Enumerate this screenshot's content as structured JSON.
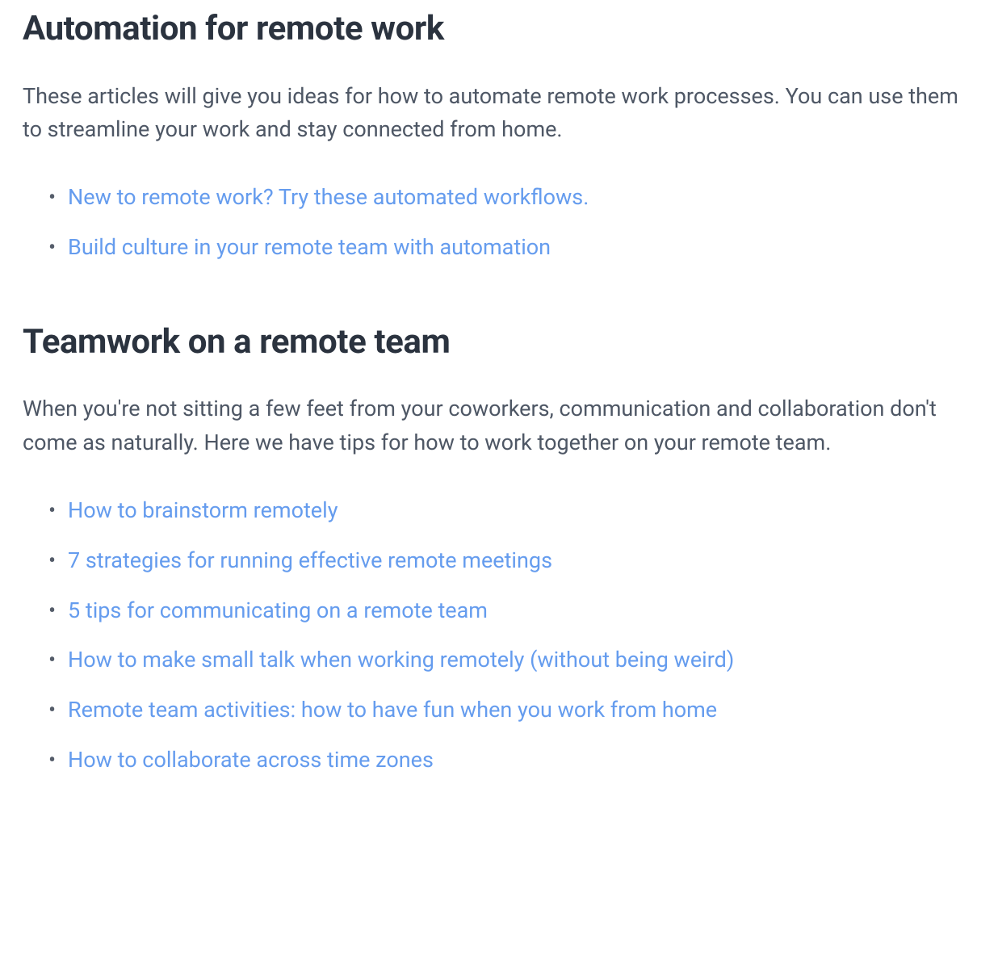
{
  "sections": [
    {
      "heading": "Automation for remote work",
      "paragraph": "These articles will give you ideas for how to automate remote work processes. You can use them to streamline your work and stay connected from home.",
      "links": [
        "New to remote work? Try these automated workflows.",
        "Build culture in your remote team with automation"
      ]
    },
    {
      "heading": "Teamwork on a remote team",
      "paragraph": "When you're not sitting a few feet from your coworkers, communication and collaboration don't come as naturally. Here we have tips for how to work together on your remote team.",
      "links": [
        "How to brainstorm remotely",
        "7 strategies for running effective remote meetings",
        "5 tips for communicating on a remote team",
        "How to make small talk when working remotely (without being weird)",
        "Remote team activities: how to have fun when you work from home",
        "How to collaborate across time zones"
      ]
    }
  ]
}
